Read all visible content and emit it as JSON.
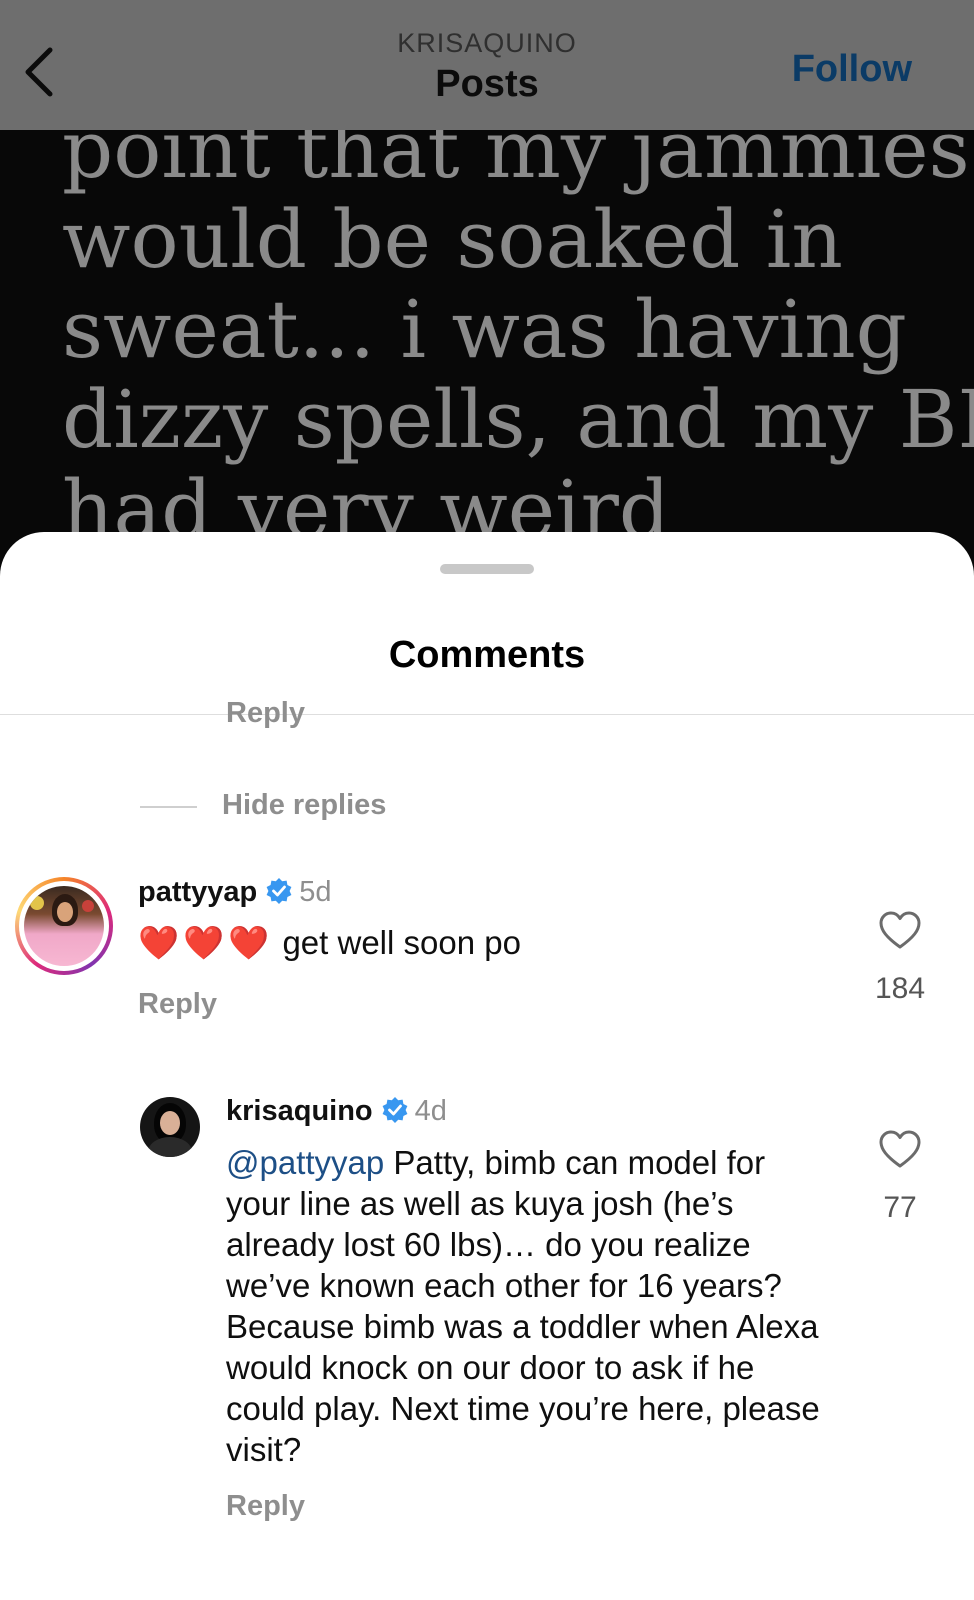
{
  "header": {
    "account": "KRISAQUINO",
    "title": "Posts",
    "follow_label": "Follow"
  },
  "post": {
    "lines": [
      "point that my jammies",
      "would be soaked in",
      "sweat... i was having",
      "dizzy spells, and my BP",
      "had very weird"
    ]
  },
  "comments_sheet": {
    "title": "Comments",
    "prev_reply_label": "Reply",
    "hide_replies_label": "Hide replies",
    "comments": [
      {
        "username": "pattyyap",
        "verified": true,
        "time": "5d",
        "emoji": "❤️❤️❤️",
        "text": "get well soon po",
        "likes": "184",
        "reply_label": "Reply"
      },
      {
        "username": "krisaquino",
        "verified": true,
        "time": "4d",
        "mention": "@pattyyap",
        "text": " Patty, bimb can model for your line as well as kuya josh (he’s already lost 60 lbs)… do you realize we’ve known each other for 16 years? Because bimb was a toddler when Alexa would knock on our door to ask if he could play. Next time you’re here, please visit?",
        "likes": "77",
        "reply_label": "Reply"
      }
    ]
  },
  "colors": {
    "topbar": "#6e6e6e",
    "follow": "#0b3b66",
    "mention": "#1d4f86",
    "verified": "#3897f0",
    "muted": "#8e8e8e",
    "heart": "#e0245e"
  }
}
